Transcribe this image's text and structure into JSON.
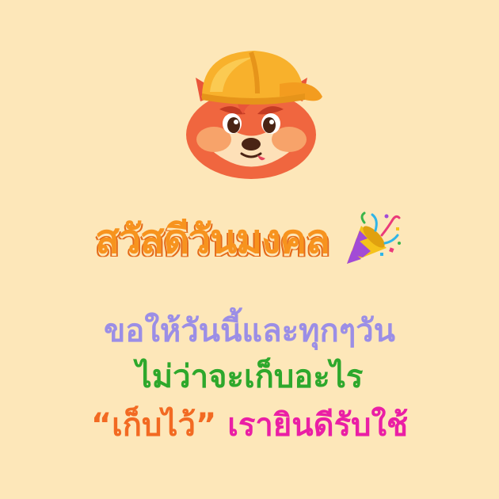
{
  "greeting": {
    "headline": "สวัสดีวันมงคล",
    "emoji": "🎉"
  },
  "message": {
    "line1": "ขอให้วันนี้และทุกๆวัน",
    "line2": "ไม่ว่าจะเก็บอะไร",
    "line3_quote": "“เก็บไว้”",
    "line3_rest": " เรายินดีรับใช้"
  },
  "colors": {
    "background": "#fde7b9",
    "headline": "#f7931e",
    "headline_shadow": "#e46a19",
    "line1": "#9b8ee6",
    "line2": "#2ea82c",
    "line3_quote": "#f26a22",
    "line3_rest": "#ea1fa5"
  },
  "icons": {
    "mascot": "fox-mascot-hardhat-icon",
    "popper": "party-popper-icon"
  }
}
